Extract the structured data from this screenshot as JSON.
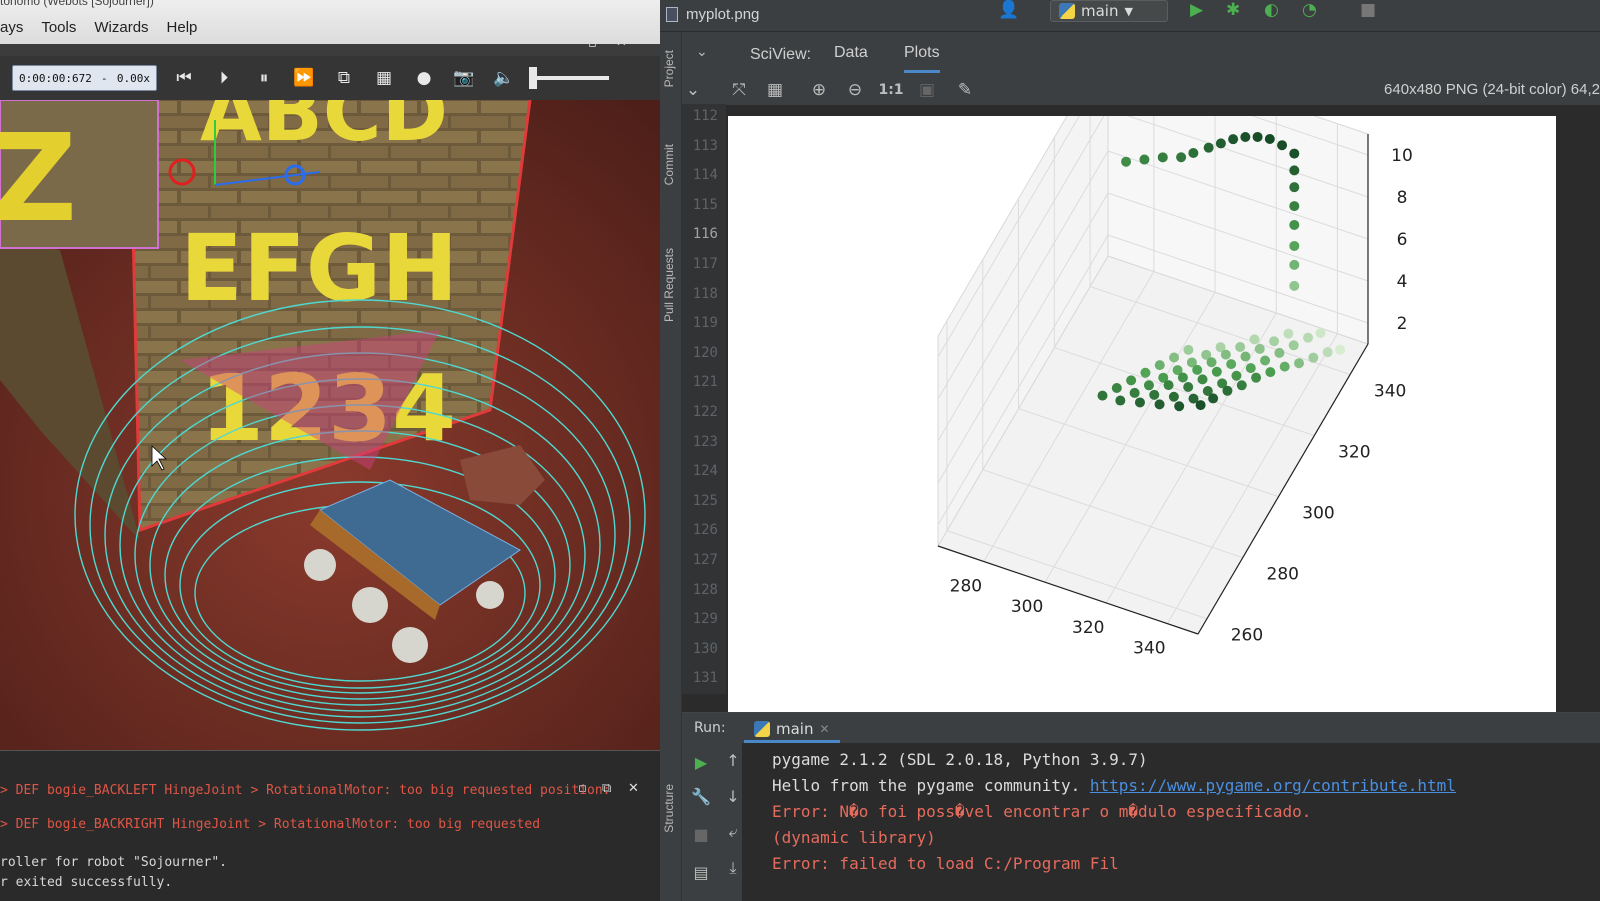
{
  "webots": {
    "title_fragment": "tonomo (Webots [Sojourner])",
    "menu": [
      "ays",
      "Tools",
      "Wizards",
      "Help"
    ],
    "toolbar": {
      "time": "0:00:00:672",
      "speed_sep": "-",
      "speed": "0.00x"
    },
    "scene": {
      "box_texts": [
        "ABCD",
        "EFGH",
        "1234"
      ],
      "side_text": "Z"
    },
    "console": [
      {
        "text": "> DEF bogie_BACKLEFT HingeJoint > RotationalMotor: too big requested position:",
        "kind": "error"
      },
      {
        "text": "> DEF bogie_BACKRIGHT HingeJoint > RotationalMotor: too big requested",
        "kind": "error"
      },
      {
        "text": "roller for robot \"Sojourner\".",
        "kind": "info"
      },
      {
        "text": "r exited successfully.",
        "kind": "info"
      }
    ]
  },
  "pycharm": {
    "file_title": "myplot.png",
    "run_config": "main",
    "side_tabs": [
      "Project",
      "Commit",
      "Pull Requests",
      "Structure"
    ],
    "sciview": {
      "label": "SciView:",
      "tabs": [
        "Data",
        "Plots"
      ],
      "active_tab": "Plots"
    },
    "plot_toolbar": {
      "actual_size_label": "1:1",
      "image_info": "640x480 PNG (24-bit color) 64,2"
    },
    "line_numbers": [
      "112",
      "113",
      "114",
      "115",
      "116",
      "117",
      "118",
      "119",
      "120",
      "121",
      "122",
      "123",
      "124",
      "125",
      "126",
      "127",
      "128",
      "129",
      "130",
      "131"
    ],
    "active_line": "116",
    "run": {
      "label": "Run:",
      "tab": "main",
      "output": [
        {
          "segments": [
            {
              "text": "pygame 2.1.2 (SDL 2.0.18, Python 3.9.7)",
              "style": "white"
            }
          ]
        },
        {
          "segments": [
            {
              "text": "Hello from the pygame community. ",
              "style": "white"
            },
            {
              "text": "https://www.pygame.org/contribute.html",
              "style": "link"
            }
          ]
        },
        {
          "segments": [
            {
              "text": "Error: N�o foi poss�vel encontrar o m�dulo especificado.",
              "style": "red"
            }
          ]
        },
        {
          "segments": [
            {
              "text": " (dynamic library)",
              "style": "red"
            }
          ]
        },
        {
          "segments": [
            {
              "text": "Error: failed to load C:/Program Fil",
              "style": "red"
            }
          ]
        }
      ]
    }
  },
  "chart_data": {
    "type": "scatter",
    "projection": "3d",
    "x_ticks": [
      280,
      300,
      320,
      340
    ],
    "y_ticks": [
      260,
      280,
      300,
      320,
      340
    ],
    "z_ticks": [
      2,
      4,
      6,
      8,
      10
    ],
    "xlim": [
      265,
      350
    ],
    "ylim": [
      255,
      350
    ],
    "zlim": [
      1,
      11
    ],
    "colormap": "Greens",
    "colors": {
      "dark": "#0f3f22",
      "light": "#e8f4e0"
    },
    "grid": true,
    "points": [
      {
        "x": 275,
        "y": 343,
        "z": 7.0
      },
      {
        "x": 281,
        "y": 343,
        "z": 7.4
      },
      {
        "x": 287,
        "y": 343,
        "z": 7.8
      },
      {
        "x": 293,
        "y": 343,
        "z": 8.1
      },
      {
        "x": 297,
        "y": 343,
        "z": 8.5
      },
      {
        "x": 302,
        "y": 343,
        "z": 9.0
      },
      {
        "x": 306,
        "y": 343,
        "z": 9.4
      },
      {
        "x": 310,
        "y": 343,
        "z": 9.8
      },
      {
        "x": 314,
        "y": 343,
        "z": 10.1
      },
      {
        "x": 318,
        "y": 343,
        "z": 10.3
      },
      {
        "x": 322,
        "y": 343,
        "z": 10.4
      },
      {
        "x": 326,
        "y": 343,
        "z": 10.3
      },
      {
        "x": 330,
        "y": 343,
        "z": 10.1
      },
      {
        "x": 330,
        "y": 343,
        "z": 9.3
      },
      {
        "x": 330,
        "y": 343,
        "z": 8.5
      },
      {
        "x": 330,
        "y": 343,
        "z": 7.6
      },
      {
        "x": 330,
        "y": 343,
        "z": 6.7
      },
      {
        "x": 330,
        "y": 343,
        "z": 5.7
      },
      {
        "x": 330,
        "y": 343,
        "z": 4.8
      },
      {
        "x": 330,
        "y": 343,
        "z": 3.8
      },
      {
        "x": 345,
        "y": 265,
        "z": 10.2
      },
      {
        "x": 345,
        "y": 272,
        "z": 9.5
      },
      {
        "x": 345,
        "y": 280,
        "z": 8.7
      },
      {
        "x": 345,
        "y": 288,
        "z": 7.8
      },
      {
        "x": 345,
        "y": 296,
        "z": 7.0
      },
      {
        "x": 345,
        "y": 304,
        "z": 6.1
      },
      {
        "x": 345,
        "y": 312,
        "z": 5.2
      },
      {
        "x": 345,
        "y": 320,
        "z": 4.2
      },
      {
        "x": 345,
        "y": 328,
        "z": 3.3
      },
      {
        "x": 345,
        "y": 336,
        "z": 2.4
      },
      {
        "x": 345,
        "y": 343,
        "z": 1.5
      },
      {
        "x": 338,
        "y": 265,
        "z": 9.8
      },
      {
        "x": 338,
        "y": 273,
        "z": 9.0
      },
      {
        "x": 338,
        "y": 281,
        "z": 8.2
      },
      {
        "x": 338,
        "y": 289,
        "z": 7.4
      },
      {
        "x": 338,
        "y": 297,
        "z": 6.6
      },
      {
        "x": 338,
        "y": 305,
        "z": 5.8
      },
      {
        "x": 338,
        "y": 313,
        "z": 5.0
      },
      {
        "x": 338,
        "y": 321,
        "z": 4.2
      },
      {
        "x": 338,
        "y": 329,
        "z": 3.4
      },
      {
        "x": 338,
        "y": 337,
        "z": 2.6
      },
      {
        "x": 338,
        "y": 344,
        "z": 1.8
      },
      {
        "x": 331,
        "y": 266,
        "z": 9.4
      },
      {
        "x": 331,
        "y": 274,
        "z": 8.6
      },
      {
        "x": 331,
        "y": 282,
        "z": 7.9
      },
      {
        "x": 331,
        "y": 290,
        "z": 7.1
      },
      {
        "x": 331,
        "y": 298,
        "z": 6.3
      },
      {
        "x": 331,
        "y": 306,
        "z": 5.5
      },
      {
        "x": 331,
        "y": 314,
        "z": 4.7
      },
      {
        "x": 331,
        "y": 322,
        "z": 3.9
      },
      {
        "x": 331,
        "y": 330,
        "z": 3.1
      },
      {
        "x": 331,
        "y": 338,
        "z": 2.3
      },
      {
        "x": 324,
        "y": 267,
        "z": 9.0
      },
      {
        "x": 324,
        "y": 275,
        "z": 8.2
      },
      {
        "x": 324,
        "y": 283,
        "z": 7.5
      },
      {
        "x": 324,
        "y": 291,
        "z": 6.7
      },
      {
        "x": 324,
        "y": 299,
        "z": 5.9
      },
      {
        "x": 324,
        "y": 307,
        "z": 5.1
      },
      {
        "x": 324,
        "y": 315,
        "z": 4.3
      },
      {
        "x": 324,
        "y": 323,
        "z": 3.5
      },
      {
        "x": 324,
        "y": 331,
        "z": 2.7
      },
      {
        "x": 317,
        "y": 268,
        "z": 8.6
      },
      {
        "x": 317,
        "y": 276,
        "z": 7.8
      },
      {
        "x": 317,
        "y": 284,
        "z": 7.0
      },
      {
        "x": 317,
        "y": 292,
        "z": 6.2
      },
      {
        "x": 317,
        "y": 300,
        "z": 5.4
      },
      {
        "x": 317,
        "y": 308,
        "z": 4.6
      },
      {
        "x": 317,
        "y": 316,
        "z": 3.8
      },
      {
        "x": 317,
        "y": 324,
        "z": 3.0
      },
      {
        "x": 310,
        "y": 270,
        "z": 8.2
      },
      {
        "x": 310,
        "y": 278,
        "z": 7.4
      },
      {
        "x": 310,
        "y": 286,
        "z": 6.6
      },
      {
        "x": 310,
        "y": 294,
        "z": 5.8
      },
      {
        "x": 310,
        "y": 302,
        "z": 5.0
      },
      {
        "x": 310,
        "y": 310,
        "z": 4.2
      },
      {
        "x": 310,
        "y": 318,
        "z": 3.4
      }
    ]
  }
}
